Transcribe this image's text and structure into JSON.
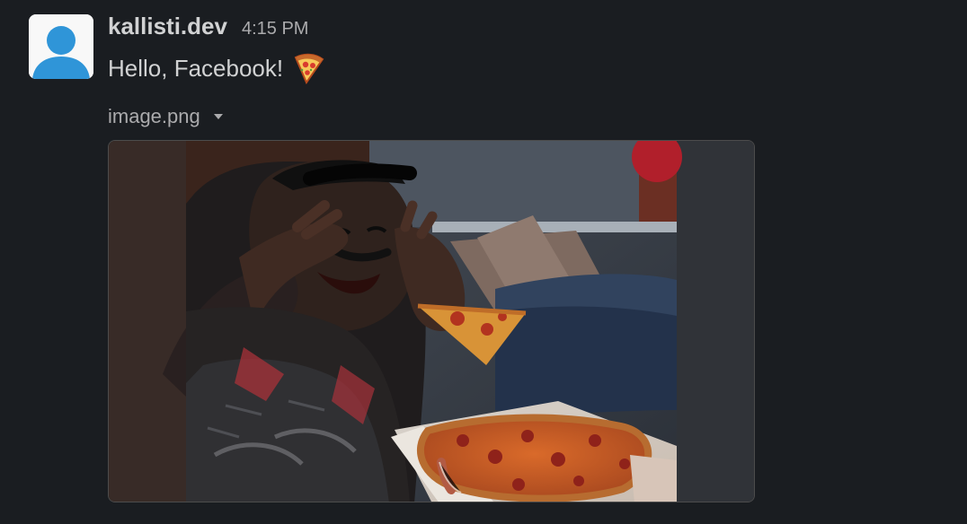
{
  "message": {
    "author": "kallisti.dev",
    "timestamp": "4:15 PM",
    "text": "Hello, Facebook!",
    "emoji": "pizza-emoji"
  },
  "attachment": {
    "file_name": "image.png",
    "menu_icon": "caret-down-icon",
    "image_description": "pizza-meme-photo"
  },
  "colors": {
    "background": "#1a1d21",
    "primary_text": "#d1d2d3",
    "secondary_text": "#ababad",
    "avatar_blue": "#2f95d8"
  }
}
